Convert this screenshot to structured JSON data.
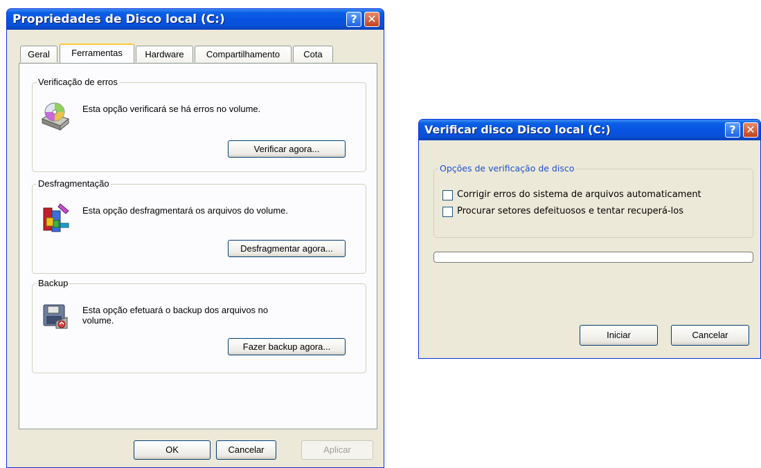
{
  "properties_dialog": {
    "title": "Propriedades de Disco local (C:)",
    "help_glyph": "?",
    "close_glyph": "✕",
    "tabs": [
      {
        "label": "Geral",
        "active": false
      },
      {
        "label": "Ferramentas",
        "active": true
      },
      {
        "label": "Hardware",
        "active": false
      },
      {
        "label": "Compartilhamento",
        "active": false
      },
      {
        "label": "Cota",
        "active": false
      }
    ],
    "groups": {
      "error_check": {
        "title": "Verificação de erros",
        "text": "Esta opção verificará se há erros no volume.",
        "button": "Verificar agora...",
        "icon": "disk-check-icon"
      },
      "defrag": {
        "title": "Desfragmentação",
        "text": "Esta opção desfragmentará os arquivos do volume.",
        "button": "Desfragmentar agora...",
        "icon": "defrag-icon"
      },
      "backup": {
        "title": "Backup",
        "text": "Esta opção efetuará o backup dos arquivos no volume.",
        "button": "Fazer backup agora...",
        "icon": "backup-icon"
      }
    },
    "footer": {
      "ok": "OK",
      "cancel": "Cancelar",
      "apply": "Aplicar",
      "apply_enabled": false
    }
  },
  "check_disk_dialog": {
    "title": "Verificar disco Disco local (C:)",
    "help_glyph": "?",
    "close_glyph": "✕",
    "options_group": "Opções de verificação de disco",
    "options": [
      {
        "label": "Corrigir erros do sistema de arquivos automaticament",
        "checked": false
      },
      {
        "label": "Procurar setores defeituosos e tentar recuperá-los",
        "checked": false
      }
    ],
    "progress": 0,
    "start_button": "Iniciar",
    "cancel_button": "Cancelar"
  },
  "colors": {
    "titlebar": "#0854e3",
    "dialog_face": "#ece9d8",
    "tab_highlight": "#ffc83c",
    "group_label": "#1d4fd1"
  }
}
